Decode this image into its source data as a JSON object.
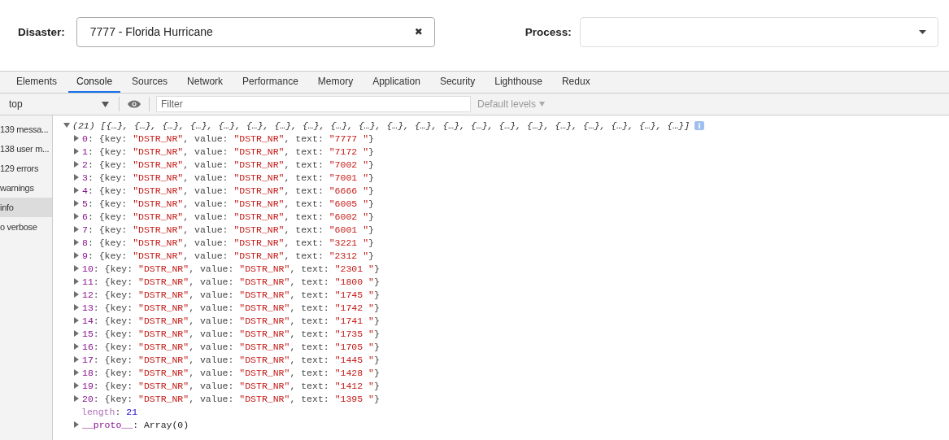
{
  "form": {
    "disaster": {
      "label": "Disaster:",
      "value": "7777 - Florida Hurricane",
      "clear": "✖"
    },
    "process": {
      "label": "Process:"
    }
  },
  "tabs": [
    {
      "label": "Elements",
      "selected": false
    },
    {
      "label": "Console",
      "selected": true
    },
    {
      "label": "Sources",
      "selected": false
    },
    {
      "label": "Network",
      "selected": false
    },
    {
      "label": "Performance",
      "selected": false
    },
    {
      "label": "Memory",
      "selected": false
    },
    {
      "label": "Application",
      "selected": false
    },
    {
      "label": "Security",
      "selected": false
    },
    {
      "label": "Lighthouse",
      "selected": false
    },
    {
      "label": "Redux",
      "selected": false
    }
  ],
  "toolbar": {
    "context": "top",
    "filter": {
      "placeholder": "Filter"
    },
    "levels": "Default levels"
  },
  "sidebar": {
    "items": [
      {
        "label": "139 messa...",
        "selected": false
      },
      {
        "label": "138 user m...",
        "selected": false
      },
      {
        "label": "129 errors",
        "selected": false
      },
      {
        "label": "warnings",
        "selected": false
      },
      {
        "label": "info",
        "selected": true
      },
      {
        "label": "o verbose",
        "selected": false
      }
    ]
  },
  "console": {
    "count": "(21)",
    "preview": "[{…}, {…}, {…}, {…}, {…}, {…}, {…}, {…}, {…}, {…}, {…}, {…}, {…}, {…}, {…}, {…}, {…}, {…}, {…}, {…}, {…}]",
    "rows": [
      {
        "index": "0",
        "parts": [
          ": {key: ",
          "\"DSTR_NR\"",
          ", value: ",
          "\"DSTR_NR\"",
          ", text: ",
          "\"7777 \"",
          "}"
        ]
      },
      {
        "index": "1",
        "parts": [
          ": {key: ",
          "\"DSTR_NR\"",
          ", value: ",
          "\"DSTR_NR\"",
          ", text: ",
          "\"7172 \"",
          "}"
        ]
      },
      {
        "index": "2",
        "parts": [
          ": {key: ",
          "\"DSTR_NR\"",
          ", value: ",
          "\"DSTR_NR\"",
          ", text: ",
          "\"7002 \"",
          "}"
        ]
      },
      {
        "index": "3",
        "parts": [
          ": {key: ",
          "\"DSTR_NR\"",
          ", value: ",
          "\"DSTR_NR\"",
          ", text: ",
          "\"7001 \"",
          "}"
        ]
      },
      {
        "index": "4",
        "parts": [
          ": {key: ",
          "\"DSTR_NR\"",
          ", value: ",
          "\"DSTR_NR\"",
          ", text: ",
          "\"6666 \"",
          "}"
        ]
      },
      {
        "index": "5",
        "parts": [
          ": {key: ",
          "\"DSTR_NR\"",
          ", value: ",
          "\"DSTR_NR\"",
          ", text: ",
          "\"6005 \"",
          "}"
        ]
      },
      {
        "index": "6",
        "parts": [
          ": {key: ",
          "\"DSTR_NR\"",
          ", value: ",
          "\"DSTR_NR\"",
          ", text: ",
          "\"6002 \"",
          "}"
        ]
      },
      {
        "index": "7",
        "parts": [
          ": {key: ",
          "\"DSTR_NR\"",
          ", value: ",
          "\"DSTR_NR\"",
          ", text: ",
          "\"6001 \"",
          "}"
        ]
      },
      {
        "index": "8",
        "parts": [
          ": {key: ",
          "\"DSTR_NR\"",
          ", value: ",
          "\"DSTR_NR\"",
          ", text: ",
          "\"3221 \"",
          "}"
        ]
      },
      {
        "index": "9",
        "parts": [
          ": {key: ",
          "\"DSTR_NR\"",
          ", value: ",
          "\"DSTR_NR\"",
          ", text: ",
          "\"2312 \"",
          "}"
        ]
      },
      {
        "index": "10",
        "parts": [
          ": {key: ",
          "\"DSTR_NR\"",
          ", value: ",
          "\"DSTR_NR\"",
          ", text: ",
          "\"2301 \"",
          "}"
        ]
      },
      {
        "index": "11",
        "parts": [
          ": {key: ",
          "\"DSTR_NR\"",
          ", value: ",
          "\"DSTR_NR\"",
          ", text: ",
          "\"1800 \"",
          "}"
        ]
      },
      {
        "index": "12",
        "parts": [
          ": {key: ",
          "\"DSTR_NR\"",
          ", value: ",
          "\"DSTR_NR\"",
          ", text: ",
          "\"1745 \"",
          "}"
        ]
      },
      {
        "index": "13",
        "parts": [
          ": {key: ",
          "\"DSTR_NR\"",
          ", value: ",
          "\"DSTR_NR\"",
          ", text: ",
          "\"1742 \"",
          "}"
        ]
      },
      {
        "index": "14",
        "parts": [
          ": {key: ",
          "\"DSTR_NR\"",
          ", value: ",
          "\"DSTR_NR\"",
          ", text: ",
          "\"1741 \"",
          "}"
        ]
      },
      {
        "index": "15",
        "parts": [
          ": {key: ",
          "\"DSTR_NR\"",
          ", value: ",
          "\"DSTR_NR\"",
          ", text: ",
          "\"1735 \"",
          "}"
        ]
      },
      {
        "index": "16",
        "parts": [
          ": {key: ",
          "\"DSTR_NR\"",
          ", value: ",
          "\"DSTR_NR\"",
          ", text: ",
          "\"1705 \"",
          "}"
        ]
      },
      {
        "index": "17",
        "parts": [
          ": {key: ",
          "\"DSTR_NR\"",
          ", value: ",
          "\"DSTR_NR\"",
          ", text: ",
          "\"1445 \"",
          "}"
        ]
      },
      {
        "index": "18",
        "parts": [
          ": {key: ",
          "\"DSTR_NR\"",
          ", value: ",
          "\"DSTR_NR\"",
          ", text: ",
          "\"1428 \"",
          "}"
        ]
      },
      {
        "index": "19",
        "parts": [
          ": {key: ",
          "\"DSTR_NR\"",
          ", value: ",
          "\"DSTR_NR\"",
          ", text: ",
          "\"1412 \"",
          "}"
        ]
      },
      {
        "index": "20",
        "parts": [
          ": {key: ",
          "\"DSTR_NR\"",
          ", value: ",
          "\"DSTR_NR\"",
          ", text: ",
          "\"1395 \"",
          "}"
        ]
      }
    ],
    "length": {
      "name": "length",
      "sep": ": ",
      "value": "21"
    },
    "proto": {
      "name": "__proto__",
      "rest": ": Array(0)"
    }
  }
}
